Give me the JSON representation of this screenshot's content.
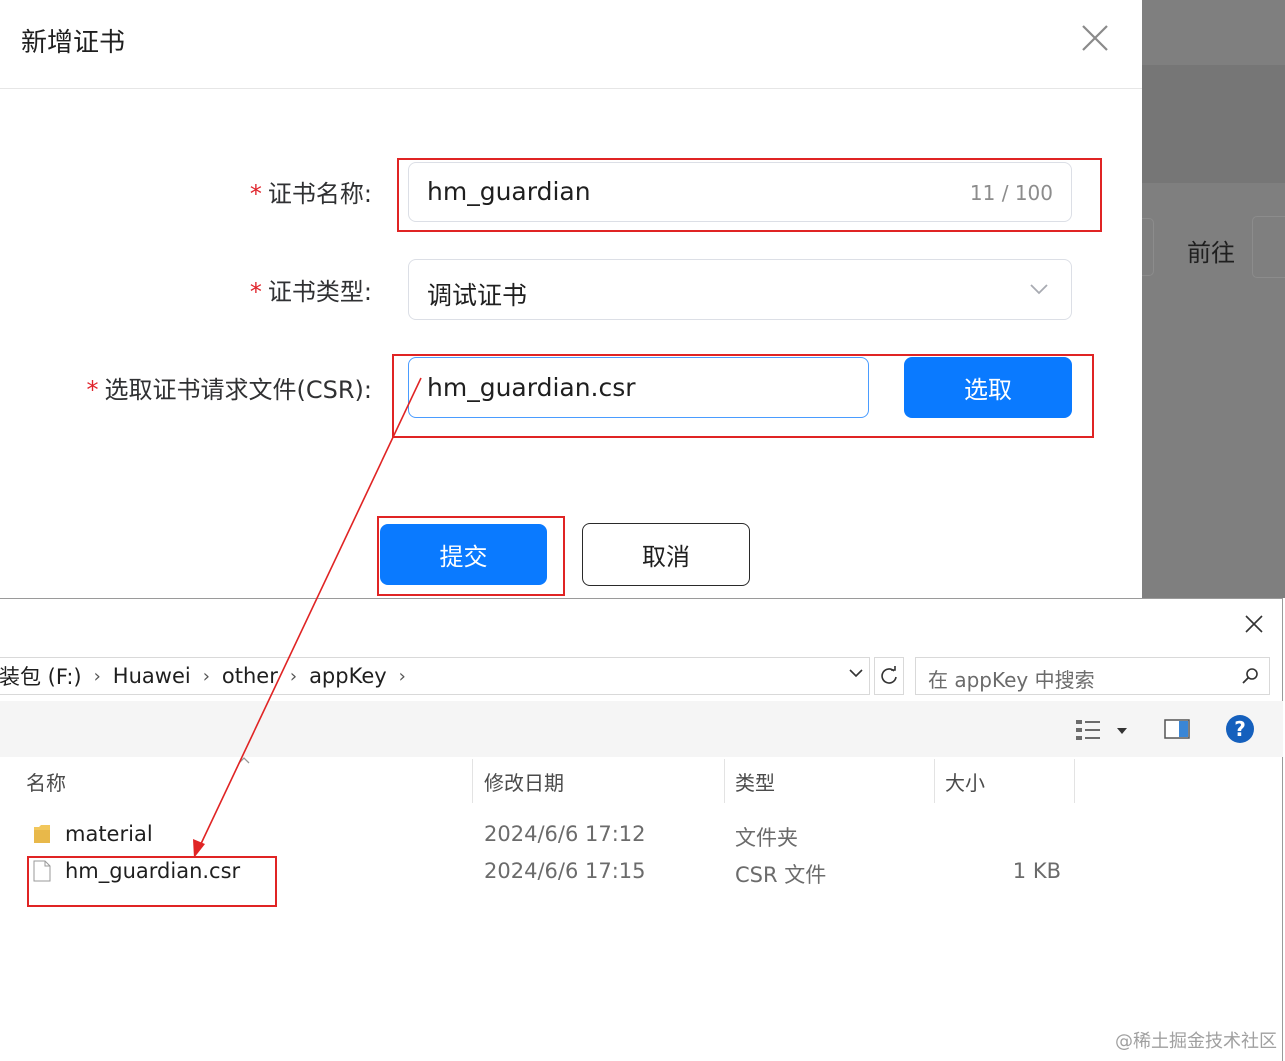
{
  "background": {
    "goto_label": "前往"
  },
  "dialog": {
    "title": "新增证书",
    "fields": {
      "cert_name": {
        "required": "*",
        "label": "证书名称:",
        "value": "hm_guardian",
        "counter": "11 / 100"
      },
      "cert_type": {
        "required": "*",
        "label": "证书类型:",
        "value": "调试证书"
      },
      "csr_file": {
        "required": "*",
        "label": "选取证书请求文件(CSR):",
        "value": "hm_guardian.csr",
        "select_button": "选取"
      }
    },
    "submit_button": "提交",
    "cancel_button": "取消"
  },
  "explorer": {
    "breadcrumbs": [
      "装包 (F:)",
      "Huawei",
      "other",
      "appKey"
    ],
    "search_placeholder": "在 appKey 中搜索",
    "help_label": "?",
    "columns": [
      "名称",
      "修改日期",
      "类型",
      "大小"
    ],
    "files": [
      {
        "name": "material",
        "modified": "2024/6/6 17:12",
        "type": "文件夹",
        "size": "",
        "icon": "folder-icon"
      },
      {
        "name": "hm_guardian.csr",
        "modified": "2024/6/6 17:15",
        "type": "CSR 文件",
        "size": "1 KB",
        "icon": "file-icon"
      }
    ]
  },
  "colors": {
    "primary": "#0a7aff",
    "required": "#e0242c",
    "annotation": "#e02424",
    "folder": "#e8b84a"
  },
  "watermark": "@稀土掘金技术社区"
}
